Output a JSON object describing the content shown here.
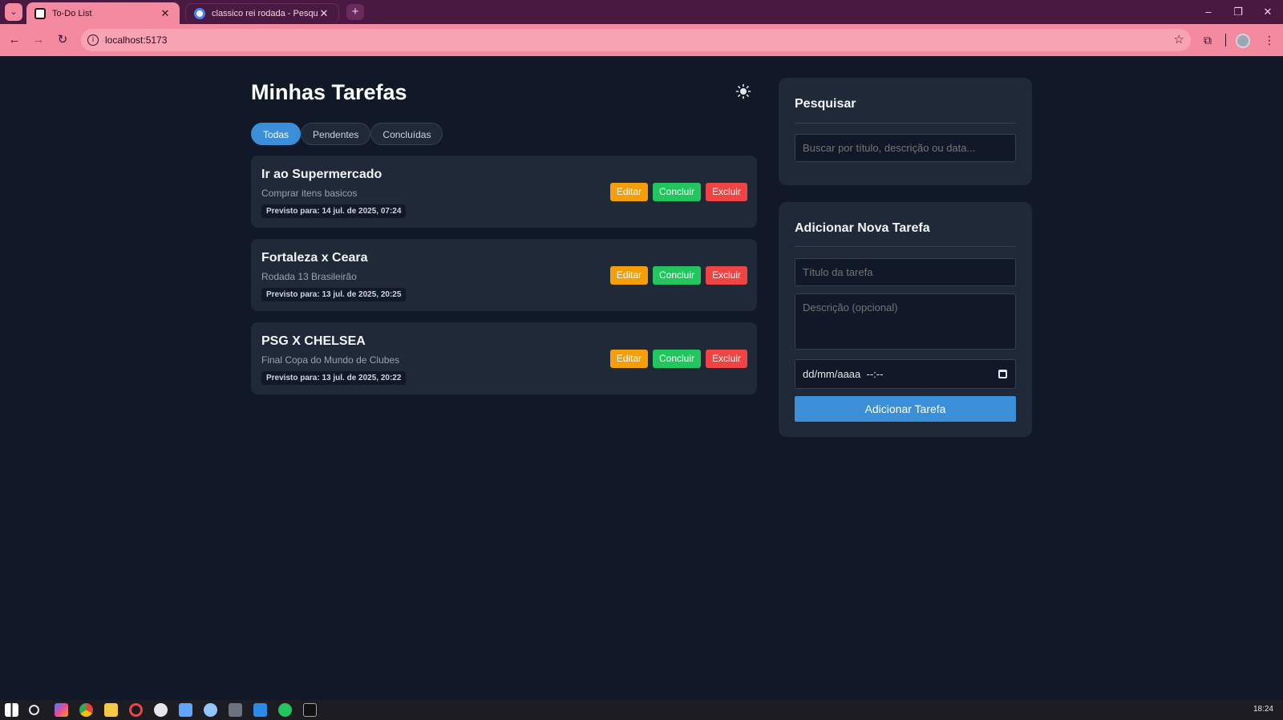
{
  "browser": {
    "tabs": [
      {
        "title": "To-Do List",
        "active": true
      },
      {
        "title": "classico rei rodada - Pesquisa G",
        "active": false
      }
    ],
    "url": "localhost:5173",
    "window_controls": {
      "minimize": "–",
      "restore": "❐",
      "close": "✕"
    }
  },
  "app": {
    "title": "Minhas Tarefas",
    "theme_icon": "sun-icon",
    "filters": [
      "Todas",
      "Pendentes",
      "Concluídas"
    ],
    "active_filter": "Todas",
    "tasks": [
      {
        "title": "Ir ao Supermercado",
        "description": "Comprar itens basicos",
        "due": "Previsto para: 14 jul. de 2025, 07:24"
      },
      {
        "title": "Fortaleza x Ceara",
        "description": "Rodada 13 Brasileirão",
        "due": "Previsto para: 13 jul. de 2025, 20:25"
      },
      {
        "title": "PSG X CHELSEA",
        "description": "Final Copa do Mundo de Clubes",
        "due": "Previsto para: 13 jul. de 2025, 20:22"
      }
    ],
    "task_actions": {
      "edit": "Editar",
      "complete": "Concluir",
      "delete": "Excluir"
    },
    "search_panel": {
      "heading": "Pesquisar",
      "placeholder": "Buscar por título, descrição ou data..."
    },
    "add_panel": {
      "heading": "Adicionar Nova Tarefa",
      "title_placeholder": "Título da tarefa",
      "description_placeholder": "Descrição (opcional)",
      "date_value": "dd/mm/aaaa  --:--",
      "submit_label": "Adicionar Tarefa"
    }
  },
  "colors": {
    "background": "#111827",
    "card": "#1f2937",
    "accent": "#3b8fd9",
    "edit": "#f59e0b",
    "complete": "#22c55e",
    "delete": "#ef4444",
    "browser_frame": "#f48aa0"
  },
  "taskbar": {
    "clock": "18:24",
    "icons": [
      "windows-start-icon",
      "search-icon",
      "copilot-icon",
      "chrome-icon",
      "file-explorer-icon",
      "opera-icon",
      "github-icon",
      "app-icon",
      "steam-icon",
      "app-icon",
      "vscode-icon",
      "xbox-icon",
      "terminal-icon"
    ]
  }
}
